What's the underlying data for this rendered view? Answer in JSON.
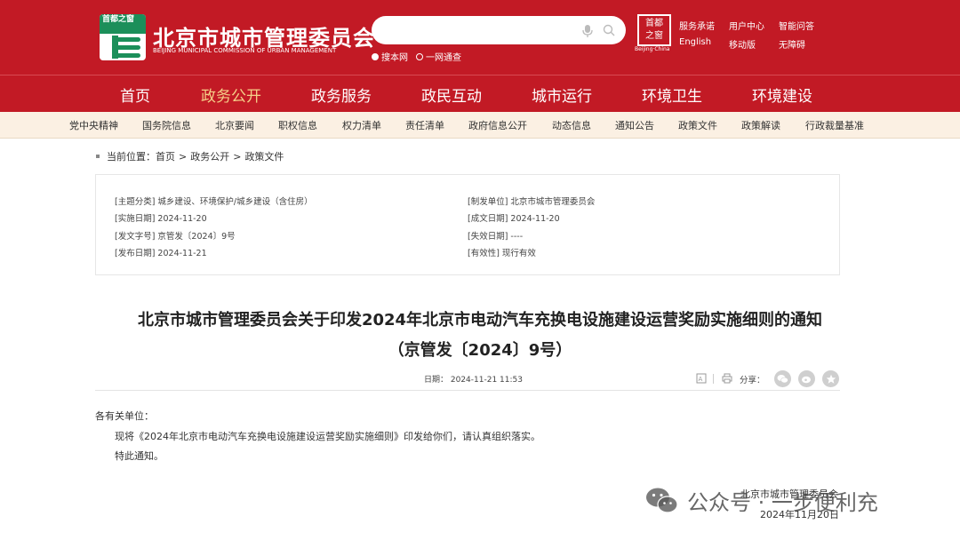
{
  "header": {
    "logo_text": "首都之窗",
    "site_title": "北京市城市管理委员会",
    "site_subtitle": "BEIJING MUNICIPAL COMMISSION OF URBAN MANAGEMENT",
    "search": {
      "value": "",
      "placeholder": ""
    },
    "search_options": [
      "搜本网",
      "一网通查"
    ],
    "capital_logo": [
      "首",
      "都",
      "之",
      "窗"
    ],
    "capital_sub": "Beijing·China",
    "links_row1": [
      "服务承诺",
      "用户中心",
      "智能问答"
    ],
    "links_row2": [
      "English",
      "移动版",
      "无障碍"
    ]
  },
  "mainnav": [
    "首页",
    "政务公开",
    "政务服务",
    "政民互动",
    "城市运行",
    "环境卫生",
    "环境建设"
  ],
  "subnav": [
    "党中央精神",
    "国务院信息",
    "北京要闻",
    "职权信息",
    "权力清单",
    "责任清单",
    "政府信息公开",
    "动态信息",
    "通知公告",
    "政策文件",
    "政策解读",
    "行政裁量基准"
  ],
  "breadcrumb": {
    "label": "当前位置：",
    "items": [
      "首页",
      "政务公开",
      "政策文件"
    ],
    "sep": ">"
  },
  "meta": {
    "left": [
      "[主题分类] 城乡建设、环境保护/城乡建设（含住房）",
      "[实施日期] 2024-11-20",
      "[发文字号] 京管发〔2024〕9号",
      "[发布日期] 2024-11-21"
    ],
    "right": [
      "[制发单位] 北京市城市管理委员会",
      "[成文日期] 2024-11-20",
      "[失效日期] ----",
      "[有效性] 现行有效"
    ]
  },
  "title": {
    "line1": "北京市城市管理委员会关于印发2024年北京市电动汽车充换电设施建设运营奖励实施细则的通知",
    "line2": "（京管发〔2024〕9号）"
  },
  "info": {
    "date": "日期：  2024-11-21 11:53",
    "share_label": "分享："
  },
  "body": {
    "salutation": "各有关单位：",
    "paragraph": "现将《2024年北京市电动汽车充换电设施建设运营奖励实施细则》印发给你们，请认真组织落实。",
    "closing": "特此通知。"
  },
  "signature": {
    "org": "北京市城市管理委员会",
    "date": "2024年11月20日"
  },
  "watermark": "公众号 · 一步便利充",
  "colors": {
    "brand_red": "#c21a25",
    "nav_active": "#f5cf88",
    "subnav_bg": "#fbf0e3",
    "logo_green": "#1c8f5a"
  }
}
